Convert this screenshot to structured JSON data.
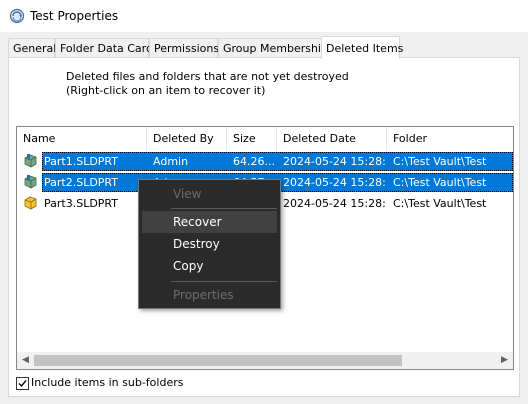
{
  "window": {
    "title": "Test Properties",
    "icon": "vault-properties-icon"
  },
  "tabs": [
    {
      "label": "General"
    },
    {
      "label": "Folder Data Card"
    },
    {
      "label": "Permissions"
    },
    {
      "label": "Group Memberships"
    },
    {
      "label": "Deleted Items",
      "active": true
    }
  ],
  "description": {
    "line1": "Deleted files and folders that are not yet destroyed",
    "line2": "(Right-click on an item to recover it)"
  },
  "list": {
    "columns": [
      "Name",
      "Deleted By",
      "Size",
      "Deleted Date",
      "Folder"
    ],
    "rows": [
      {
        "name": "Part1.SLDPRT",
        "deleted_by": "Admin",
        "size": "64.26...",
        "date": "2024-05-24 15:28:...",
        "folder": "C:\\Test Vault\\Test",
        "selected": true,
        "icon": "part-icon-green"
      },
      {
        "name": "Part2.SLDPRT",
        "deleted_by": "Ad",
        "size": "64.57...",
        "date": "2024-05-24 15:28:...",
        "folder": "C:\\Test Vault\\Test",
        "selected": true,
        "icon": "part-icon-green"
      },
      {
        "name": "Part3.SLDPRT",
        "deleted_by": "",
        "size": "",
        "date": "2024-05-24 15:28:...",
        "folder": "C:\\Test Vault\\Test",
        "selected": false,
        "icon": "part-icon-yellow"
      }
    ]
  },
  "context_menu": {
    "items": [
      {
        "label": "View",
        "disabled": true
      },
      {
        "label": "Recover",
        "highlighted": true
      },
      {
        "label": "Destroy"
      },
      {
        "label": "Copy"
      },
      {
        "label": "Properties",
        "disabled": true
      }
    ]
  },
  "footer": {
    "include_subfolders_label": "Include items in sub-folders",
    "include_subfolders_checked": true
  },
  "colors": {
    "selection": "#0078d7",
    "menu_bg": "#2b2b2b",
    "menu_highlight": "#414141"
  }
}
